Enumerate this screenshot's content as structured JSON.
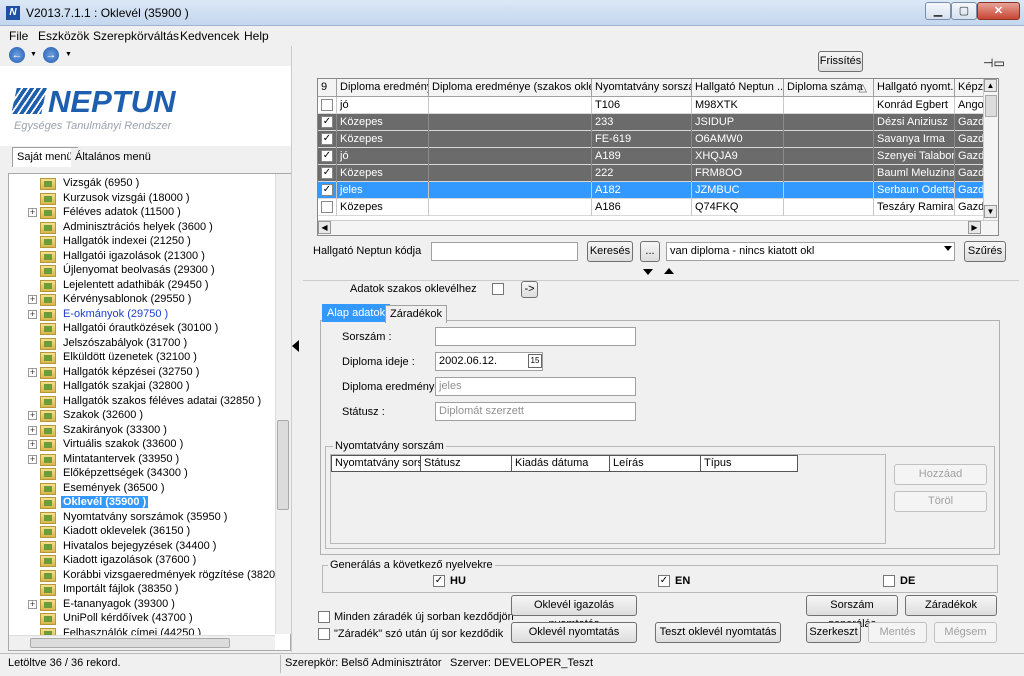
{
  "window": {
    "title": "V2013.7.1.1 : Oklevél (35900  )",
    "icon_letter": "N"
  },
  "menu": {
    "items": [
      "File",
      "Eszközök",
      "Szerepkörváltás",
      "Kedvencek",
      "Help"
    ]
  },
  "logo": {
    "text": "NEPTUN",
    "subtitle": "Egységes Tanulmányi Rendszer"
  },
  "left_tabs": [
    "Saját menü",
    "Általános menü"
  ],
  "tree": {
    "items": [
      {
        "label": "Vizsgák (6950  )",
        "expandable": false,
        "state": "normal"
      },
      {
        "label": "Kurzusok vizsgái (18000  )",
        "expandable": false,
        "state": "normal"
      },
      {
        "label": "Féléves adatok (11500  )",
        "expandable": true,
        "state": "normal"
      },
      {
        "label": "Adminisztrációs helyek (3600  )",
        "expandable": false,
        "state": "normal"
      },
      {
        "label": "Hallgatók indexei (21250  )",
        "expandable": false,
        "state": "normal"
      },
      {
        "label": "Hallgatói igazolások (21300  )",
        "expandable": false,
        "state": "normal"
      },
      {
        "label": "Újlenyomat beolvasás (29300  )",
        "expandable": false,
        "state": "normal"
      },
      {
        "label": "Lejelentett adathibák (29450  )",
        "expandable": false,
        "state": "normal"
      },
      {
        "label": "Kérvénysablonok (29550  )",
        "expandable": true,
        "state": "normal"
      },
      {
        "label": "E-okmányok (29750  )",
        "expandable": true,
        "state": "link"
      },
      {
        "label": "Hallgatói órautközések (30100  )",
        "expandable": false,
        "state": "normal"
      },
      {
        "label": "Jelszószabályok (31700  )",
        "expandable": false,
        "state": "normal"
      },
      {
        "label": "Elküldött üzenetek (32100  )",
        "expandable": false,
        "state": "normal"
      },
      {
        "label": "Hallgatók képzései (32750  )",
        "expandable": true,
        "state": "normal"
      },
      {
        "label": "Hallgatók szakjai (32800  )",
        "expandable": false,
        "state": "normal"
      },
      {
        "label": "Hallgatók szakos féléves adatai (32850  )",
        "expandable": false,
        "state": "normal"
      },
      {
        "label": "Szakok (32600  )",
        "expandable": true,
        "state": "normal"
      },
      {
        "label": "Szakirányok (33300  )",
        "expandable": true,
        "state": "normal"
      },
      {
        "label": "Virtuális szakok (33600  )",
        "expandable": true,
        "state": "normal"
      },
      {
        "label": "Mintatantervek (33950  )",
        "expandable": true,
        "state": "normal"
      },
      {
        "label": "Előképzettségek (34300  )",
        "expandable": false,
        "state": "normal"
      },
      {
        "label": "Események (36500  )",
        "expandable": false,
        "state": "normal"
      },
      {
        "label": "Oklevél (35900  )",
        "expandable": false,
        "state": "selected"
      },
      {
        "label": "Nyomtatvány sorszámok (35950  )",
        "expandable": false,
        "state": "normal"
      },
      {
        "label": "Kiadott oklevelek (36150  )",
        "expandable": false,
        "state": "normal"
      },
      {
        "label": "Hivatalos bejegyzések (34400  )",
        "expandable": false,
        "state": "normal"
      },
      {
        "label": "Kiadott igazolások (37600  )",
        "expandable": false,
        "state": "normal"
      },
      {
        "label": "Korábbi vizsgaeredmények rögzítése (38200  )",
        "expandable": false,
        "state": "normal"
      },
      {
        "label": "Importált fájlok (38350  )",
        "expandable": false,
        "state": "normal"
      },
      {
        "label": "E-tananyagok (39300  )",
        "expandable": true,
        "state": "normal"
      },
      {
        "label": "UniPoll kérdőívek (43700  )",
        "expandable": false,
        "state": "normal"
      },
      {
        "label": "Felhasználók címei (44250  )",
        "expandable": false,
        "state": "normal"
      }
    ]
  },
  "toolbar": {
    "refresh_label": "Frissítés",
    "pin_icon": "pin-icon"
  },
  "grid": {
    "corner_label": "9",
    "columns": [
      "Diploma eredménye",
      "Diploma eredménye (szakos oklevél)",
      "Nyomtatvány sorszám",
      "Hallgató Neptun ...",
      "Diploma száma",
      "Hallgató nyomt...",
      "Képzé"
    ],
    "sort_indicator": "△",
    "rows": [
      {
        "checked": false,
        "style": "normal",
        "cells": [
          "jó",
          "",
          "T106",
          "M98XTK",
          "",
          "Konrád Egbert",
          "Angol"
        ]
      },
      {
        "checked": true,
        "style": "dark",
        "cells": [
          "Közepes",
          "",
          "233",
          "JSIDUP",
          "",
          "Dézsi Aniziusz",
          "Gazd"
        ]
      },
      {
        "checked": true,
        "style": "dark",
        "cells": [
          "Közepes",
          "",
          "FE-619",
          "O6AMW0",
          "",
          "Savanya Irma",
          "Gazd"
        ]
      },
      {
        "checked": true,
        "style": "dark",
        "cells": [
          "jó",
          "",
          "A189",
          "XHQJA9",
          "",
          "Szenyei Talabor",
          "Gazd"
        ]
      },
      {
        "checked": true,
        "style": "dark",
        "cells": [
          "Közepes",
          "",
          "222",
          "FRM8OO",
          "",
          "Bauml Meluzina",
          "Gazd"
        ]
      },
      {
        "checked": true,
        "style": "selected",
        "cells": [
          "jeles",
          "",
          "A182",
          "JZMBUC",
          "",
          "Serbaun Odetta",
          "Gazd"
        ]
      },
      {
        "checked": false,
        "style": "normal",
        "cells": [
          "Közepes",
          "",
          "A186",
          "Q74FKQ",
          "",
          "Teszáry Ramira",
          "Gazd"
        ]
      }
    ]
  },
  "filter": {
    "label": "Hallgató Neptun kódja",
    "value": "",
    "search_label": "Keresés",
    "ellipsis_label": "...",
    "dropdown_value": "van diploma - nincs kiatott okl",
    "filter_label": "Szűrés"
  },
  "szakos": {
    "label": "Adatok szakos oklevélhez",
    "checked": false,
    "arrow_label": "->"
  },
  "detail_tabs": [
    "Alap adatok",
    "Záradékok"
  ],
  "form": {
    "sorszam_label": "Sorszám :",
    "sorszam_value": "",
    "ideje_label": "Diploma ideje :",
    "ideje_value": "2002.06.12.",
    "calendar_icon_text": "15",
    "eredmeny_label": "Diploma eredménye",
    "eredmeny_value": "jeles",
    "statusz_label": "Státusz :",
    "statusz_value": "Diplomát szerzett"
  },
  "nyomtatvany": {
    "title": "Nyomtatvány sorszám",
    "columns": [
      "Nyomtatvány sors...",
      "Státusz",
      "Kiadás dátuma",
      "Leírás",
      "Típus"
    ],
    "add_label": "Hozzáad",
    "delete_label": "Töröl"
  },
  "generalas": {
    "title": "Generálás a következő nyelvekre",
    "langs": [
      {
        "code": "HU",
        "checked": true
      },
      {
        "code": "EN",
        "checked": true
      },
      {
        "code": "DE",
        "checked": false
      }
    ]
  },
  "options": {
    "opt1": "Minden záradék új sorban kezdődjön",
    "opt2": "\"Záradék\" szó után új sor kezdődik"
  },
  "actions": {
    "igazolas_nyomtatas": "Oklevél igazolás nyomtatás",
    "sorszam_generalas": "Sorszám generálás",
    "zaradekok": "Záradékok",
    "oklevel_nyomtatas": "Oklevél nyomtatás",
    "teszt_nyomtatas": "Teszt oklevél nyomtatás",
    "szerkeszt": "Szerkeszt",
    "mentes": "Mentés",
    "megsem": "Mégsem"
  },
  "status": {
    "records": "Letöltve 36 / 36 rekord.",
    "role": "Szerepkör: Belső Adminisztrátor",
    "server": "Szerver: DEVELOPER_Teszt"
  }
}
